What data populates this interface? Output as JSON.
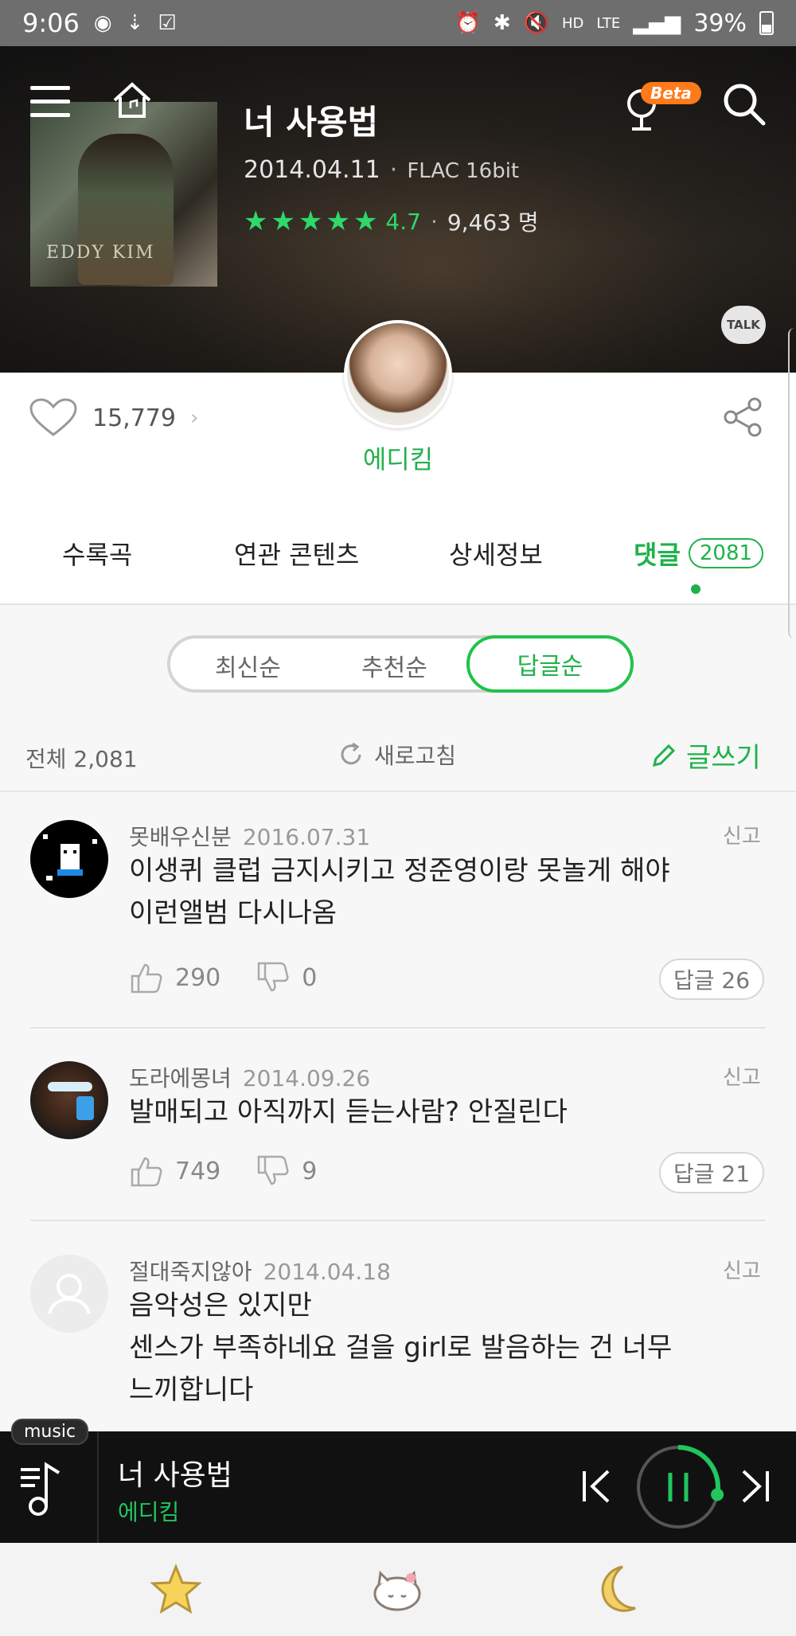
{
  "status_bar": {
    "time": "9:06",
    "network": "LTE",
    "battery": "39%"
  },
  "album": {
    "title": "너 사용법",
    "release_date": "2014.04.11",
    "format": "FLAC 16bit",
    "rating": "4.7",
    "rating_stars": 5,
    "rating_count": "9,463 명",
    "beta_badge": "Beta",
    "talk_label": "TALK",
    "art_text": "EDDY KIM"
  },
  "likes": {
    "count": "15,779",
    "chevron": "›"
  },
  "artist": {
    "name": "에디킴"
  },
  "tabs": [
    {
      "label": "수록곡"
    },
    {
      "label": "연관 콘텐츠"
    },
    {
      "label": "상세정보"
    },
    {
      "label": "댓글",
      "count": "2081",
      "active": true
    }
  ],
  "sort": {
    "options": [
      "최신순",
      "추천순",
      "답글순"
    ],
    "active": "답글순"
  },
  "summary": {
    "total": "전체 2,081",
    "refresh": "새로고침",
    "write": "글쓰기"
  },
  "comments": [
    {
      "author": "못배우신분",
      "date": "2016.07.31",
      "report": "신고",
      "text": "이생퀴 클럽 금지시키고 정준영이랑 못놀게 해야\n이런앨범 다시나옴",
      "likes": "290",
      "dislikes": "0",
      "reply": "답글 26"
    },
    {
      "author": "도라에몽녀",
      "date": "2014.09.26",
      "report": "신고",
      "text": "발매되고 아직까지 듣는사람? 안질린다",
      "likes": "749",
      "dislikes": "9",
      "reply": "답글 21"
    },
    {
      "author": "절대죽지않아",
      "date": "2014.04.18",
      "report": "신고",
      "text": "음악성은 있지만\n센스가 부족하네요 걸을 girl로 발음하는 건 너무\n느끼합니다"
    }
  ],
  "player": {
    "tag": "music",
    "title": "너 사용법",
    "artist": "에디킴",
    "progress": 0.28
  },
  "colors": {
    "accent": "#1fb24b",
    "accent_light": "#2ed86b",
    "beta": "#ff7a1a",
    "player_bg": "#111111"
  },
  "icons": {
    "menu": "menu-icon",
    "home": "home-icon",
    "mic": "mic-icon",
    "search": "search-icon",
    "heart": "heart-icon",
    "share": "share-icon",
    "refresh": "refresh-icon",
    "pencil": "pencil-icon",
    "thumbs_up": "thumbs-up-icon",
    "thumbs_down": "thumbs-down-icon",
    "playlist": "playlist-icon",
    "prev": "previous-icon",
    "pause": "pause-icon",
    "next": "next-icon",
    "nav": [
      "star-icon",
      "hello-kitty-icon",
      "moon-icon"
    ]
  }
}
